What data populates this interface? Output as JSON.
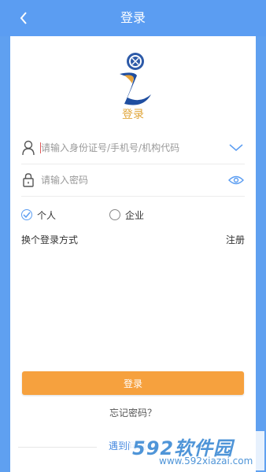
{
  "header": {
    "title": "登录",
    "back_icon": "chevron-left-icon",
    "background": "#5b9df2"
  },
  "app": {
    "name": "登录",
    "logo": "app-logo"
  },
  "form": {
    "account": {
      "placeholder": "请输入身份证号/手机号/机构代码",
      "value": "",
      "icon": "user-icon",
      "right_icon": "chevron-down-icon"
    },
    "password": {
      "placeholder": "请输入密码",
      "value": "",
      "icon": "lock-icon",
      "right_icon": "eye-icon"
    },
    "user_type": {
      "options": [
        "个人",
        "企业"
      ],
      "selected": "个人"
    },
    "switch_login_label": "换个登录方式",
    "register_label": "注册",
    "submit_label": "登录",
    "submit_color": "#f6a13e",
    "forgot_label": "忘记密码？",
    "help_label": "遇到问题"
  },
  "watermark": {
    "brand": "592软件园",
    "url": "www.592xiazai.com"
  }
}
